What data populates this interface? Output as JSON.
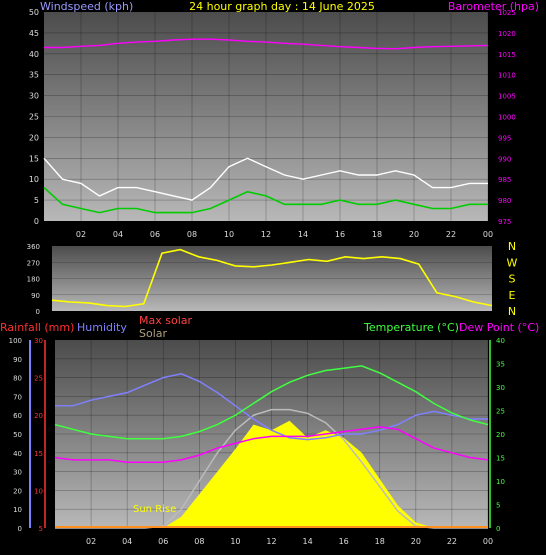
{
  "header": {
    "windspeed_label": "Windspeed (kph)",
    "title": "24 hour graph day : 14 June 2025",
    "barometer_label": "Barometer (hpa)"
  },
  "lower_labels": {
    "rainfall": "Rainfall (mm)",
    "humidity": "Humidity",
    "max_solar": "Max solar",
    "solar": "Solar",
    "temperature": "Temperature (°C)",
    "dew_point": "Dew Point (°C)",
    "sun_rise": "Sun Rise"
  },
  "colors": {
    "windspeed_label": "#9a9aff",
    "title": "#ffff00",
    "barometer": "#ff00ff",
    "rainfall": "#ff3030",
    "humidity": "#8080ff",
    "max_solar": "#ff4040",
    "solar": "#b0a080",
    "temperature": "#40ff40",
    "dew_point": "#ff00ff",
    "wind_direction": "#ffff00",
    "solar_fill": "#ffff00",
    "wind_gust": "#ffffff",
    "wind_avg": "#00cc00"
  },
  "chart_data": [
    {
      "id": "wind",
      "type": "line",
      "x_hours": [
        0,
        1,
        2,
        3,
        4,
        5,
        6,
        7,
        8,
        9,
        10,
        11,
        12,
        13,
        14,
        15,
        16,
        17,
        18,
        19,
        20,
        21,
        22,
        23,
        24
      ],
      "x_tick_labels": [
        "02",
        "04",
        "06",
        "08",
        "10",
        "12",
        "14",
        "16",
        "18",
        "20",
        "22",
        "00"
      ],
      "left_axis": {
        "label": "Windspeed (kph)",
        "ylim": [
          0,
          50
        ],
        "ticks": [
          "0",
          "5",
          "10",
          "15",
          "20",
          "25",
          "30",
          "35",
          "40",
          "45",
          "50"
        ]
      },
      "right_axis": {
        "label": "Barometer (hpa)",
        "ylim": [
          975,
          1025
        ],
        "ticks": [
          "975",
          "980",
          "985",
          "990",
          "995",
          "1000",
          "1005",
          "1010",
          "1015",
          "1020",
          "1025"
        ]
      },
      "series": [
        {
          "name": "Barometer (hpa)",
          "axis": "right",
          "values": [
            1016.5,
            1016.5,
            1016.8,
            1017.0,
            1017.5,
            1017.8,
            1018.0,
            1018.3,
            1018.5,
            1018.5,
            1018.3,
            1018.0,
            1017.8,
            1017.5,
            1017.3,
            1017.0,
            1016.7,
            1016.5,
            1016.3,
            1016.2,
            1016.5,
            1016.7,
            1016.8,
            1016.9,
            1017.0
          ]
        },
        {
          "axis": "left",
          "values": [
            15,
            10,
            9,
            6,
            8,
            8,
            7,
            6,
            5,
            8,
            13,
            15,
            13,
            11,
            10,
            11,
            12,
            11,
            11,
            12,
            11,
            8,
            8,
            9,
            9
          ]
        },
        {
          "axis": "left",
          "values": [
            8,
            4,
            3,
            2,
            3,
            3,
            2,
            2,
            2,
            3,
            5,
            7,
            6,
            4,
            4,
            4,
            5,
            4,
            4,
            5,
            4,
            3,
            3,
            4,
            4
          ]
        }
      ]
    },
    {
      "id": "direction",
      "type": "line",
      "x_hours": [
        0,
        1,
        2,
        3,
        4,
        5,
        6,
        7,
        8,
        9,
        10,
        11,
        12,
        13,
        14,
        15,
        16,
        17,
        18,
        19,
        20,
        21,
        22,
        23,
        24
      ],
      "left_axis": {
        "ylim": [
          0,
          360
        ],
        "ticks": [
          "0",
          "90",
          "180",
          "270",
          "360"
        ]
      },
      "right_axis": {
        "ticks": [
          "N",
          "W",
          "S",
          "E",
          "N"
        ]
      },
      "series": [
        {
          "axis": "left",
          "values": [
            60,
            50,
            45,
            30,
            25,
            40,
            320,
            340,
            300,
            280,
            250,
            245,
            255,
            270,
            285,
            275,
            300,
            290,
            300,
            290,
            260,
            100,
            80,
            50,
            30
          ]
        }
      ]
    },
    {
      "id": "lower",
      "type": "line",
      "x_hours": [
        0,
        1,
        2,
        3,
        4,
        5,
        6,
        7,
        8,
        9,
        10,
        11,
        12,
        13,
        14,
        15,
        16,
        17,
        18,
        19,
        20,
        21,
        22,
        23,
        24
      ],
      "x_tick_labels": [
        "02",
        "04",
        "06",
        "08",
        "10",
        "12",
        "14",
        "16",
        "18",
        "20",
        "22",
        "00"
      ],
      "axes": {
        "humidity": {
          "ylim": [
            0,
            100
          ],
          "ticks": [
            "0",
            "10",
            "20",
            "30",
            "40",
            "50",
            "60",
            "70",
            "80",
            "90",
            "100"
          ]
        },
        "rainfall": {
          "ylim": [
            5,
            30
          ],
          "ticks": [
            "5",
            "10",
            "15",
            "20",
            "25",
            "30"
          ]
        },
        "temperature": {
          "ylim": [
            0,
            40
          ],
          "ticks": [
            "0",
            "5",
            "10",
            "15",
            "20",
            "25",
            "30",
            "35",
            "40"
          ]
        }
      },
      "series": [
        {
          "name": "Humidity",
          "axis": "humidity",
          "values": [
            65,
            65,
            68,
            70,
            72,
            76,
            80,
            82,
            78,
            72,
            65,
            58,
            52,
            48,
            47,
            48,
            50,
            50,
            52,
            55,
            60,
            62,
            60,
            58,
            58
          ]
        },
        {
          "name": "Temperature (°C)",
          "axis": "temperature",
          "values": [
            22,
            21,
            20,
            19.5,
            19,
            19,
            19,
            19.5,
            20.5,
            22,
            24,
            26.5,
            29,
            31,
            32.5,
            33.5,
            34,
            34.5,
            33,
            31,
            29,
            26.5,
            24.5,
            23,
            22
          ]
        },
        {
          "name": "Dew Point (°C)",
          "axis": "temperature",
          "values": [
            15,
            14.5,
            14.5,
            14.5,
            14,
            14,
            14,
            14.5,
            15.5,
            17,
            18,
            19,
            19.5,
            19.5,
            19.5,
            20,
            20.5,
            21,
            21.5,
            21,
            19,
            17,
            16,
            15,
            14.5
          ]
        },
        {
          "name": "Max solar",
          "axis": "humidity",
          "values": [
            0,
            0,
            0,
            0,
            0,
            0,
            1,
            10,
            25,
            40,
            52,
            60,
            63,
            63,
            61,
            56,
            47,
            35,
            22,
            9,
            1,
            0,
            0,
            0,
            0
          ]
        },
        {
          "name": "Solar",
          "axis": "humidity",
          "values": [
            0,
            0,
            0,
            0,
            0,
            0,
            0,
            6,
            18,
            30,
            42,
            55,
            52,
            57,
            48,
            52,
            48,
            40,
            26,
            12,
            3,
            0,
            0,
            0,
            0
          ]
        },
        {
          "name": "Rainfall (mm)",
          "axis": "rainfall",
          "values": [
            5,
            5,
            5,
            5,
            5,
            5,
            5,
            5,
            5,
            5,
            5,
            5,
            5,
            5,
            5,
            5,
            5,
            5,
            5,
            5,
            5,
            5,
            5,
            5,
            5
          ]
        }
      ]
    }
  ]
}
